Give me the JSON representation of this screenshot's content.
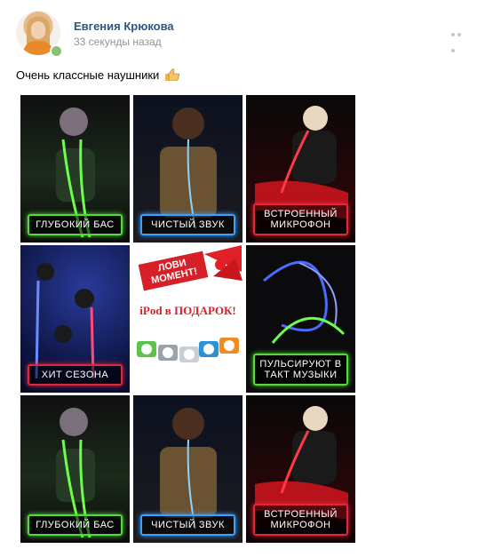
{
  "post": {
    "author": "Евгения Крюкова",
    "time": "33 секунды назад",
    "text": "Очень классные наушники"
  },
  "tiles": [
    {
      "caption": "ГЛУБОКИЙ БАС"
    },
    {
      "caption": "ЧИСТЫЙ ЗВУК"
    },
    {
      "caption": "ВСТРОЕННЫЙ МИКРОФОН"
    },
    {
      "caption": "ХИТ СЕЗОНА"
    },
    {
      "title": "ЛОВИ МОМЕНТ!",
      "subtitle": "iPod в ПОДАРОК!"
    },
    {
      "caption": "ПУЛЬСИРУЮТ В ТАКТ МУЗЫКИ"
    },
    {
      "caption": "ГЛУБОКИЙ БАС"
    },
    {
      "caption": "ЧИСТЫЙ ЗВУК"
    },
    {
      "caption": "ВСТРОЕННЫЙ МИКРОФОН"
    }
  ]
}
